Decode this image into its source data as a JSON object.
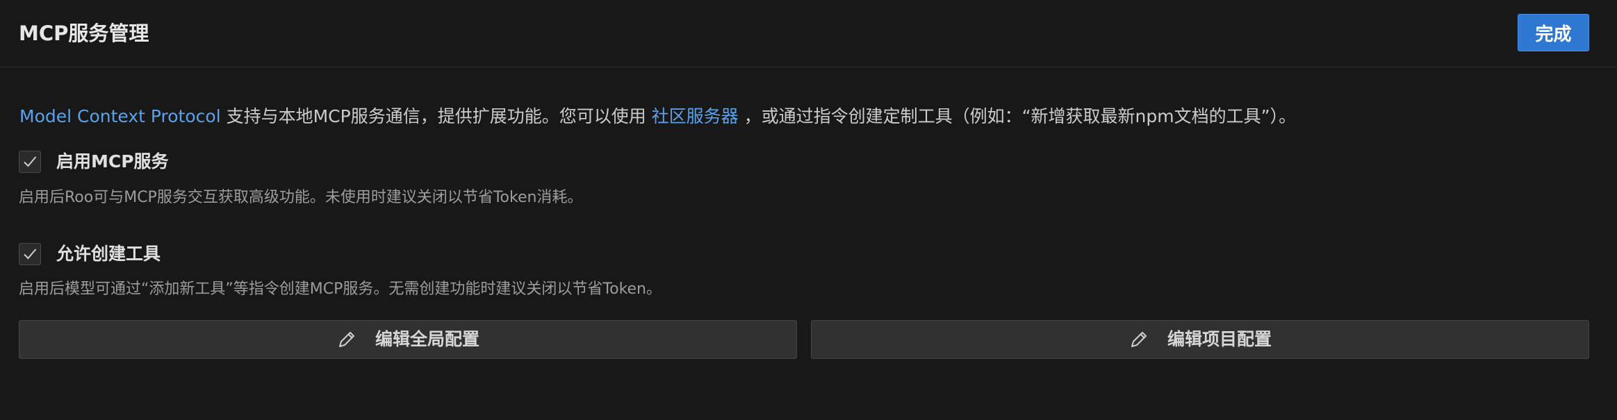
{
  "header": {
    "title": "MCP服务管理",
    "done_label": "完成"
  },
  "intro": {
    "link_protocol": "Model Context Protocol",
    "text_1": " 支持与本地MCP服务通信，提供扩展功能。您可以使用 ",
    "link_community": "社区服务器",
    "text_2": " ，或通过指令创建定制工具（例如：“新增获取最新npm文档的工具”）。"
  },
  "options": [
    {
      "label": "启用MCP服务",
      "checked": true,
      "description": "启用后Roo可与MCP服务交互获取高级功能。未使用时建议关闭以节省Token消耗。"
    },
    {
      "label": "允许创建工具",
      "checked": true,
      "description": "启用后模型可通过“添加新工具”等指令创建MCP服务。无需创建功能时建议关闭以节省Token。"
    }
  ],
  "actions": {
    "edit_global_label": "编辑全局配置",
    "edit_project_label": "编辑项目配置"
  },
  "colors": {
    "background": "#181818",
    "accent": "#2f78d1",
    "link": "#5aa2ec"
  }
}
